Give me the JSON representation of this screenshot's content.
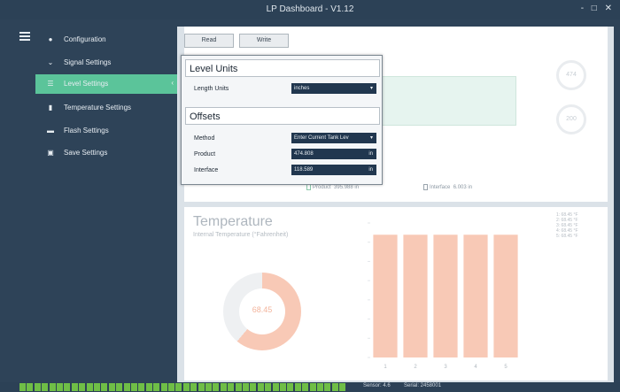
{
  "window": {
    "title": "LP Dashboard - V1.12",
    "controls": "- □ ✕"
  },
  "sidebar": {
    "items": [
      {
        "label": "Configuration",
        "icon": "gear-icon",
        "glyph": "●"
      },
      {
        "label": "Signal Settings",
        "icon": "chevron-down-icon",
        "glyph": "⌄"
      },
      {
        "label": "Level Settings",
        "icon": "grid-icon",
        "glyph": "☰"
      },
      {
        "label": "Temperature Settings",
        "icon": "thermometer-icon",
        "glyph": "▮"
      },
      {
        "label": "Flash Settings",
        "icon": "flash-drive-icon",
        "glyph": "▬"
      },
      {
        "label": "Save Settings",
        "icon": "save-icon",
        "glyph": "▣"
      }
    ],
    "active_index": 2
  },
  "toolbar": {
    "read_label": "Read",
    "write_label": "Write"
  },
  "popup": {
    "level_units": {
      "title": "Level Units",
      "length_units_label": "Length Units",
      "length_units_value": "inches"
    },
    "offsets": {
      "title": "Offsets",
      "method_label": "Method",
      "method_value": "Enter Current Tank Lev",
      "product_label": "Product",
      "product_value": "474.808",
      "product_unit": "in",
      "interface_label": "Interface",
      "interface_value": "118.589",
      "interface_unit": "in"
    }
  },
  "level_panel": {
    "gauge1": "474",
    "gauge2": "200",
    "legend_product_label": "Product",
    "legend_product_value": "395.988 in",
    "legend_interface_label": "Interface",
    "legend_interface_value": "6.003 in"
  },
  "temperature": {
    "title": "Temperature",
    "subtitle": "Internal Temperature (°Fahrenheit)",
    "value": "68.45",
    "legend": [
      "1: 68.45 °F",
      "2: 68.45 °F",
      "3: 68.45 °F",
      "4: 68.45 °F",
      "5: 68.45 °F"
    ]
  },
  "chart_data": {
    "type": "bar",
    "categories": [
      "1",
      "2",
      "3",
      "4",
      "5"
    ],
    "values": [
      68.45,
      68.45,
      68.45,
      68.45,
      68.45
    ],
    "ylim": [
      0,
      75
    ],
    "color": "#f8c9b6"
  },
  "status": {
    "sensor_label": "Sensor: 4.6",
    "serial_label": "Serial: 2458001",
    "led_color": "#6fbe46"
  }
}
